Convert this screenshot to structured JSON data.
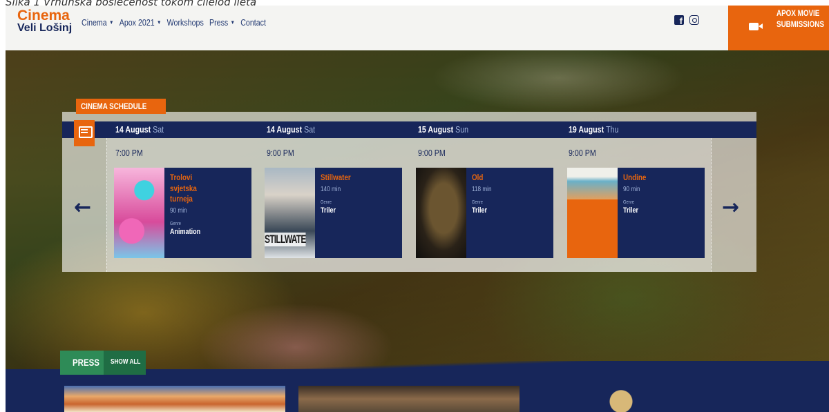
{
  "caption": "Slika 1 Vrhunska posjećenost tokom cijelog ljeta",
  "brand": {
    "line1": "Cinema",
    "line2": "Veli Lošinj"
  },
  "nav": [
    {
      "label": "Cinema",
      "dropdown": true
    },
    {
      "label": "Apox 2021",
      "dropdown": true
    },
    {
      "label": "Workshops",
      "dropdown": false
    },
    {
      "label": "Press",
      "dropdown": true
    },
    {
      "label": "Contact",
      "dropdown": false
    }
  ],
  "social": [
    "facebook-icon",
    "instagram-icon"
  ],
  "submissions": {
    "label": "APOX MOVIE\nSUBMISSIONS",
    "icon": "video-camera-icon"
  },
  "schedule": {
    "tag": "CINEMA SCHEDULE",
    "genre_label": "Genre",
    "days": [
      {
        "date": "14 August",
        "dow": "Sat",
        "time": "7:00 PM",
        "title": "Trolovi svjetska turneja",
        "duration": "90 min",
        "genre": "Animation"
      },
      {
        "date": "14 August",
        "dow": "Sat",
        "time": "9:00 PM",
        "title": "Stillwater",
        "duration": "140 min",
        "genre": "Triler"
      },
      {
        "date": "15 August",
        "dow": "Sun",
        "time": "9:00 PM",
        "title": "Old",
        "duration": "118 min",
        "genre": "Triler"
      },
      {
        "date": "19 August",
        "dow": "Thu",
        "time": "9:00 PM",
        "title": "Undine",
        "duration": "90 min",
        "genre": "Triler"
      }
    ],
    "prev_icon": "arrow-left-icon",
    "next_icon": "arrow-right-icon"
  },
  "press": {
    "label": "PRESS",
    "show_all": "SHOW ALL"
  },
  "colors": {
    "navy": "#17265a",
    "orange": "#e8650e",
    "green": "#2e8b57"
  }
}
